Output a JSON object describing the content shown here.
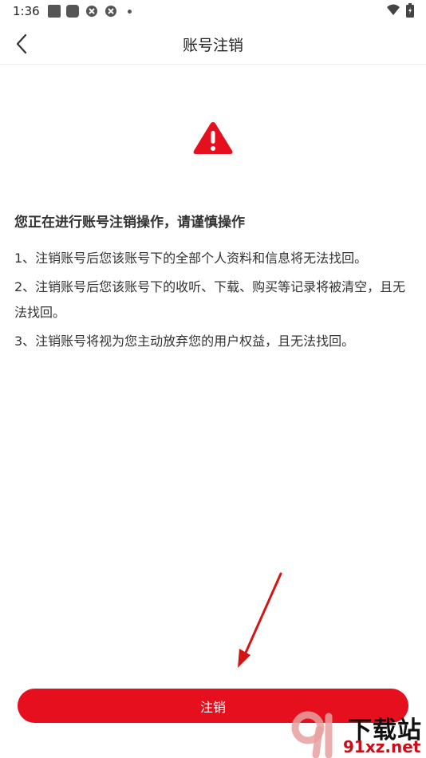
{
  "status_bar": {
    "time": "1:36",
    "icons": [
      "square-icon",
      "rounded-square-icon",
      "circle-icon",
      "circle-icon",
      "dot-icon",
      "wifi-icon",
      "battery-icon"
    ]
  },
  "header": {
    "title": "账号注销",
    "back_icon": "chevron-left-icon"
  },
  "warning": {
    "icon": "warning-icon",
    "color": "#e60f1e"
  },
  "content": {
    "heading": "您正在进行账号注销操作，请谨慎操作",
    "rules": [
      "1、注销账号后您该账号下的全部个人资料和信息将无法找回。",
      "2、注销账号后您该账号下的收听、下载、购买等记录将被清空，且无法找回。",
      "3、注销账号将视为您主动放弃您的用户权益，且无法找回。"
    ]
  },
  "action": {
    "cancel_button_label": "注销",
    "button_color": "#e60f1e"
  },
  "watermark": {
    "title": "下载站",
    "url": "91xz.net"
  }
}
